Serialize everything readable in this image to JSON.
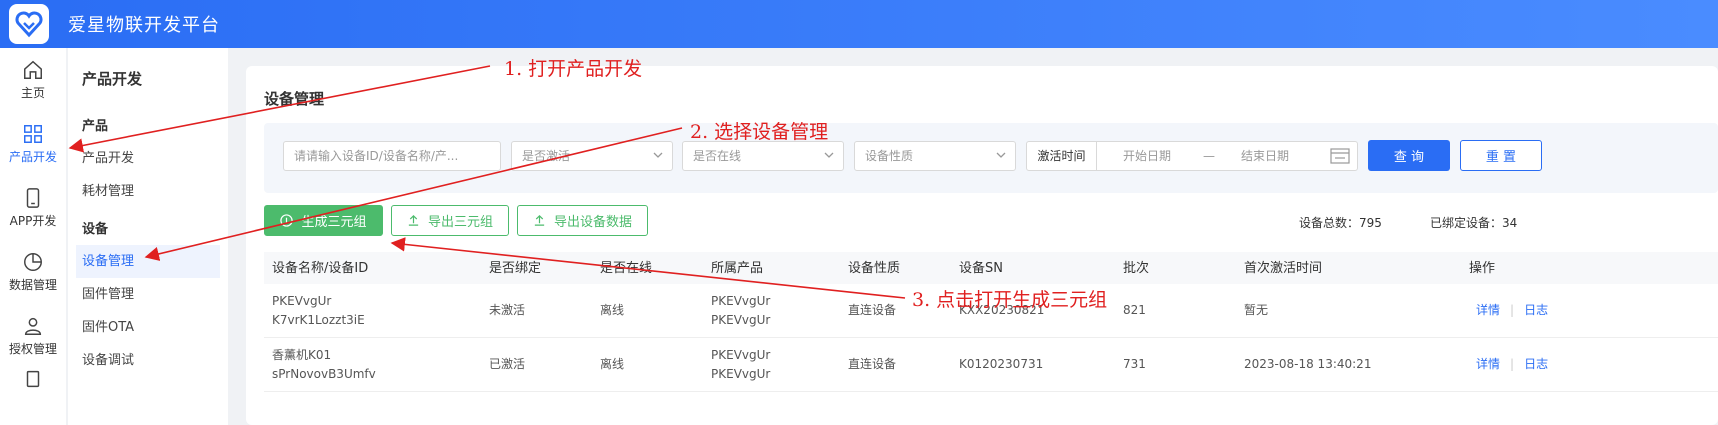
{
  "app": {
    "title": "爱星物联开发平台"
  },
  "rail": [
    {
      "label": "主页",
      "icon": "home-icon"
    },
    {
      "label": "产品开发",
      "icon": "grid-icon",
      "active": true
    },
    {
      "label": "APP开发",
      "icon": "phone-icon"
    },
    {
      "label": "数据管理",
      "icon": "pie-chart-icon"
    },
    {
      "label": "授权管理",
      "icon": "user-icon"
    }
  ],
  "subnav": {
    "heading": "产品开发",
    "group1": "产品",
    "g1_items": [
      "产品开发",
      "耗材管理"
    ],
    "group2": "设备",
    "g2_items": [
      "设备管理",
      "固件管理",
      "固件OTA",
      "设备调试"
    ]
  },
  "page": {
    "title": "设备管理"
  },
  "filter": {
    "search_placeholder": "请请输入设备ID/设备名称/产...",
    "activated_placeholder": "是否激活",
    "online_placeholder": "是否在线",
    "nature_placeholder": "设备性质",
    "date_label": "激活时间",
    "start_placeholder": "开始日期",
    "date_sep": "—",
    "end_placeholder": "结束日期",
    "query_label": "查 询",
    "reset_label": "重 置"
  },
  "actions": {
    "generate_label": "生成三元组",
    "export_triple_label": "导出三元组",
    "export_device_label": "导出设备数据"
  },
  "stats": {
    "total": "设备总数：795",
    "bound": "已绑定设备：34"
  },
  "table": {
    "headers": [
      "设备名称/设备ID",
      "是否绑定",
      "是否在线",
      "所属产品",
      "设备性质",
      "设备SN",
      "批次",
      "首次激活时间",
      "操作"
    ],
    "rows": [
      {
        "name": "PKEVvgUr",
        "id": "K7vrK1Lozzt3iE",
        "bound": "未激活",
        "online": "离线",
        "product1": "PKEVvgUr",
        "product2": "PKEVvgUr",
        "nature": "直连设备",
        "sn": "KXX20230821",
        "batch": "821",
        "activated": "暂无",
        "detail": "详情",
        "log": "日志"
      },
      {
        "name": "香薰机K01",
        "id": "sPrNovovB3Umfv",
        "bound": "已激活",
        "online": "离线",
        "product1": "PKEVvgUr",
        "product2": "PKEVvgUr",
        "nature": "直连设备",
        "sn": "K0120230731",
        "batch": "731",
        "activated": "2023-08-18 13:40:21",
        "detail": "详情",
        "log": "日志"
      }
    ]
  },
  "annotations": {
    "step1": "1. 打开产品开发",
    "step2": "2.  选择设备管理",
    "step3": "3.  点击打开生成三元组"
  },
  "colors": {
    "primary": "#2a6df4",
    "green": "#4cbb6c",
    "annotation": "#e02020"
  }
}
